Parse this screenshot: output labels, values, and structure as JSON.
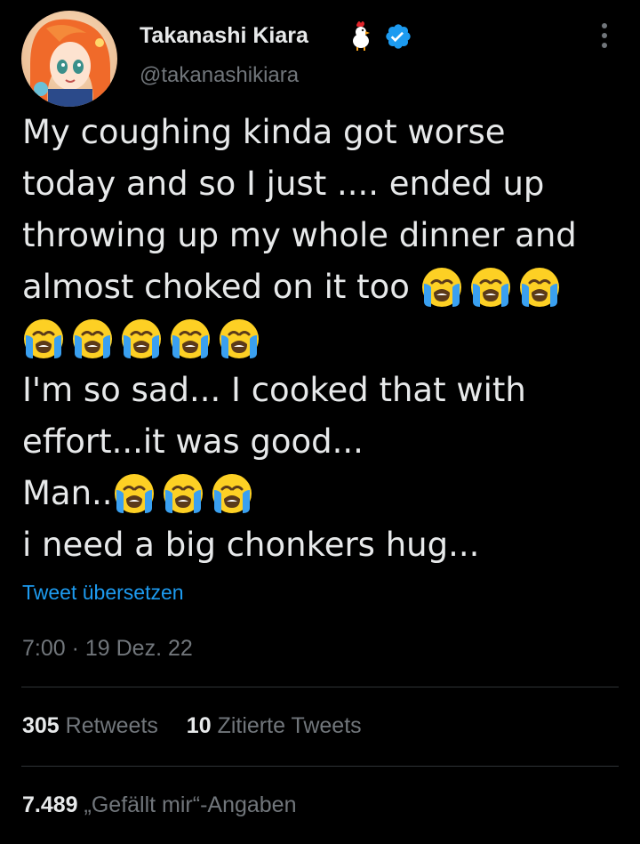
{
  "author": {
    "name": "Takanashi Kiara",
    "handle": "@takanashikiara",
    "name_emoji": "chicken-icon",
    "verified_badge": "verified-badge-icon",
    "verified_color": "#1d9bf0"
  },
  "tweet": {
    "lines": [
      "My coughing kinda got worse",
      "today and so I just .... ended up",
      "throwing up my whole dinner and",
      "almost choked on it too",
      "",
      "I'm so sad... I cooked that with",
      "effort...it was good...",
      "Man..",
      "i need a big chonkers hug..."
    ],
    "emoji_name": "loudly-crying-face-icon"
  },
  "translate_link": "Tweet übersetzen",
  "timestamp": "7:00 · 19 Dez. 22",
  "stats": {
    "retweets_count": "305",
    "retweets_label": "Retweets",
    "quotes_count": "10",
    "quotes_label": "Zitierte Tweets",
    "likes_count": "7.489",
    "likes_label": "„Gefällt mir“-Angaben"
  },
  "colors": {
    "background": "#000000",
    "text": "#e7e9ea",
    "secondary": "#71767b",
    "accent": "#1d9bf0",
    "divider": "#2f3336"
  }
}
